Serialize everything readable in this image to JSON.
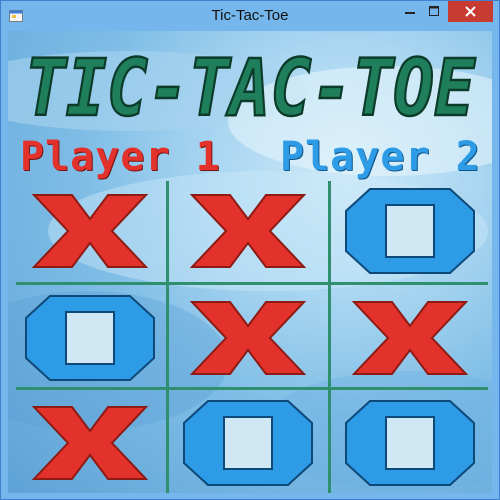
{
  "window": {
    "title": "Tic-Tac-Toe",
    "close_color": "#c73b30"
  },
  "game": {
    "title": "TIC-TAC-TOE",
    "title_color": "#1f7f5c",
    "player1": {
      "label": "Player 1",
      "mark": "X",
      "color": "#e3322c"
    },
    "player2": {
      "label": "Player 2",
      "mark": "O",
      "color": "#2d9be6"
    },
    "board": [
      [
        "X",
        "X",
        "O"
      ],
      [
        "O",
        "X",
        "X"
      ],
      [
        "X",
        "O",
        "O"
      ]
    ],
    "grid_color": "#2f8f6e"
  }
}
